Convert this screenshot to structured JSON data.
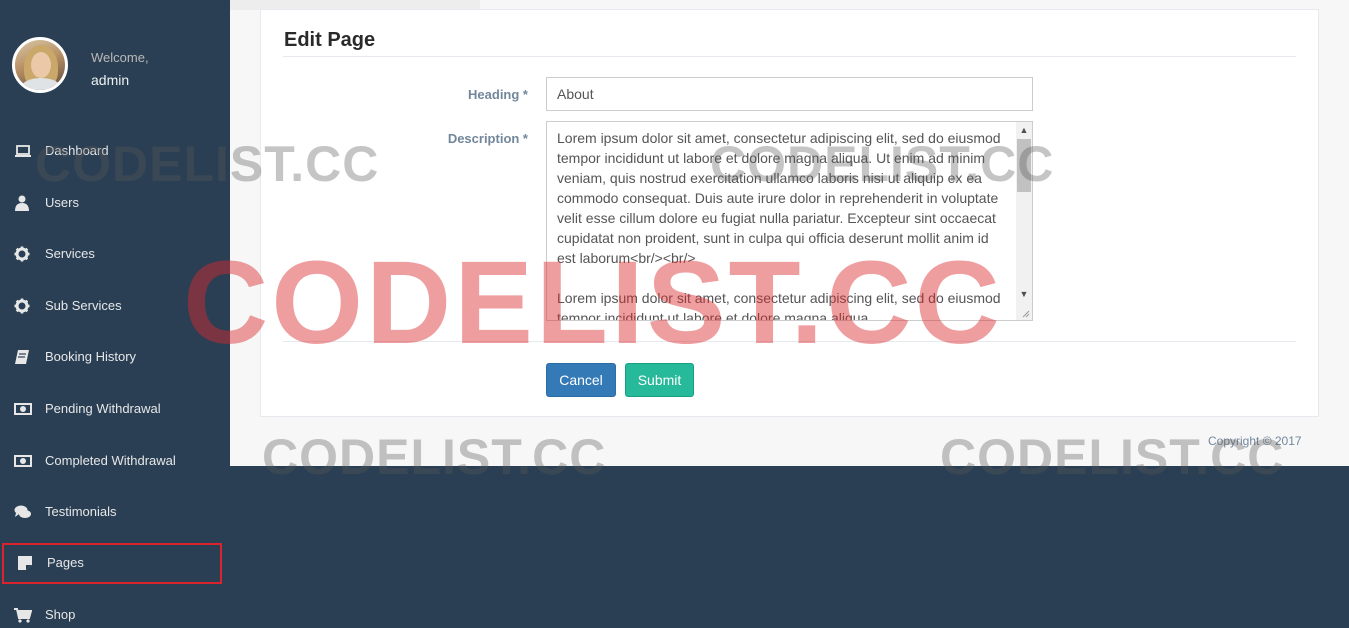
{
  "sidebar": {
    "welcome": "Welcome,",
    "username": "admin",
    "items": [
      {
        "label": "Dashboard",
        "icon": "laptop-icon"
      },
      {
        "label": "Users",
        "icon": "user-icon"
      },
      {
        "label": "Services",
        "icon": "gear-icon"
      },
      {
        "label": "Sub Services",
        "icon": "gear-icon"
      },
      {
        "label": "Booking History",
        "icon": "book-icon"
      },
      {
        "label": "Pending Withdrawal",
        "icon": "money-icon"
      },
      {
        "label": "Completed Withdrawal",
        "icon": "money-icon"
      },
      {
        "label": "Testimonials",
        "icon": "comments-icon"
      },
      {
        "label": "Pages",
        "icon": "sticky-note-icon",
        "active": true
      },
      {
        "label": "Shop",
        "icon": "cart-icon"
      }
    ]
  },
  "page": {
    "title": "Edit Page",
    "heading_label": "Heading *",
    "heading_value": "About",
    "description_label": "Description *",
    "description_value": "Lorem ipsum dolor sit amet, consectetur adipiscing elit, sed do eiusmod tempor incididunt ut labore et dolore magna aliqua. Ut enim ad minim veniam, quis nostrud exercitation ullamco laboris nisi ut aliquip ex ea commodo consequat. Duis aute irure dolor in reprehenderit in voluptate velit esse cillum dolore eu fugiat nulla pariatur. Excepteur sint occaecat cupidatat non proident, sunt in culpa qui officia deserunt mollit anim id est laborum<br/><br/>\n\nLorem ipsum dolor sit amet, consectetur adipiscing elit, sed do eiusmod tempor incididunt ut labore et dolore magna aliqua.",
    "cancel_label": "Cancel",
    "submit_label": "Submit"
  },
  "footer": {
    "copyright": "Copyright © 2017"
  },
  "watermark": "CODELIST.CC",
  "colors": {
    "sidebar_bg": "#2a3f54",
    "cancel_button": "#337ab7",
    "submit_button": "#26b99a",
    "active_outline": "#d9232d"
  }
}
